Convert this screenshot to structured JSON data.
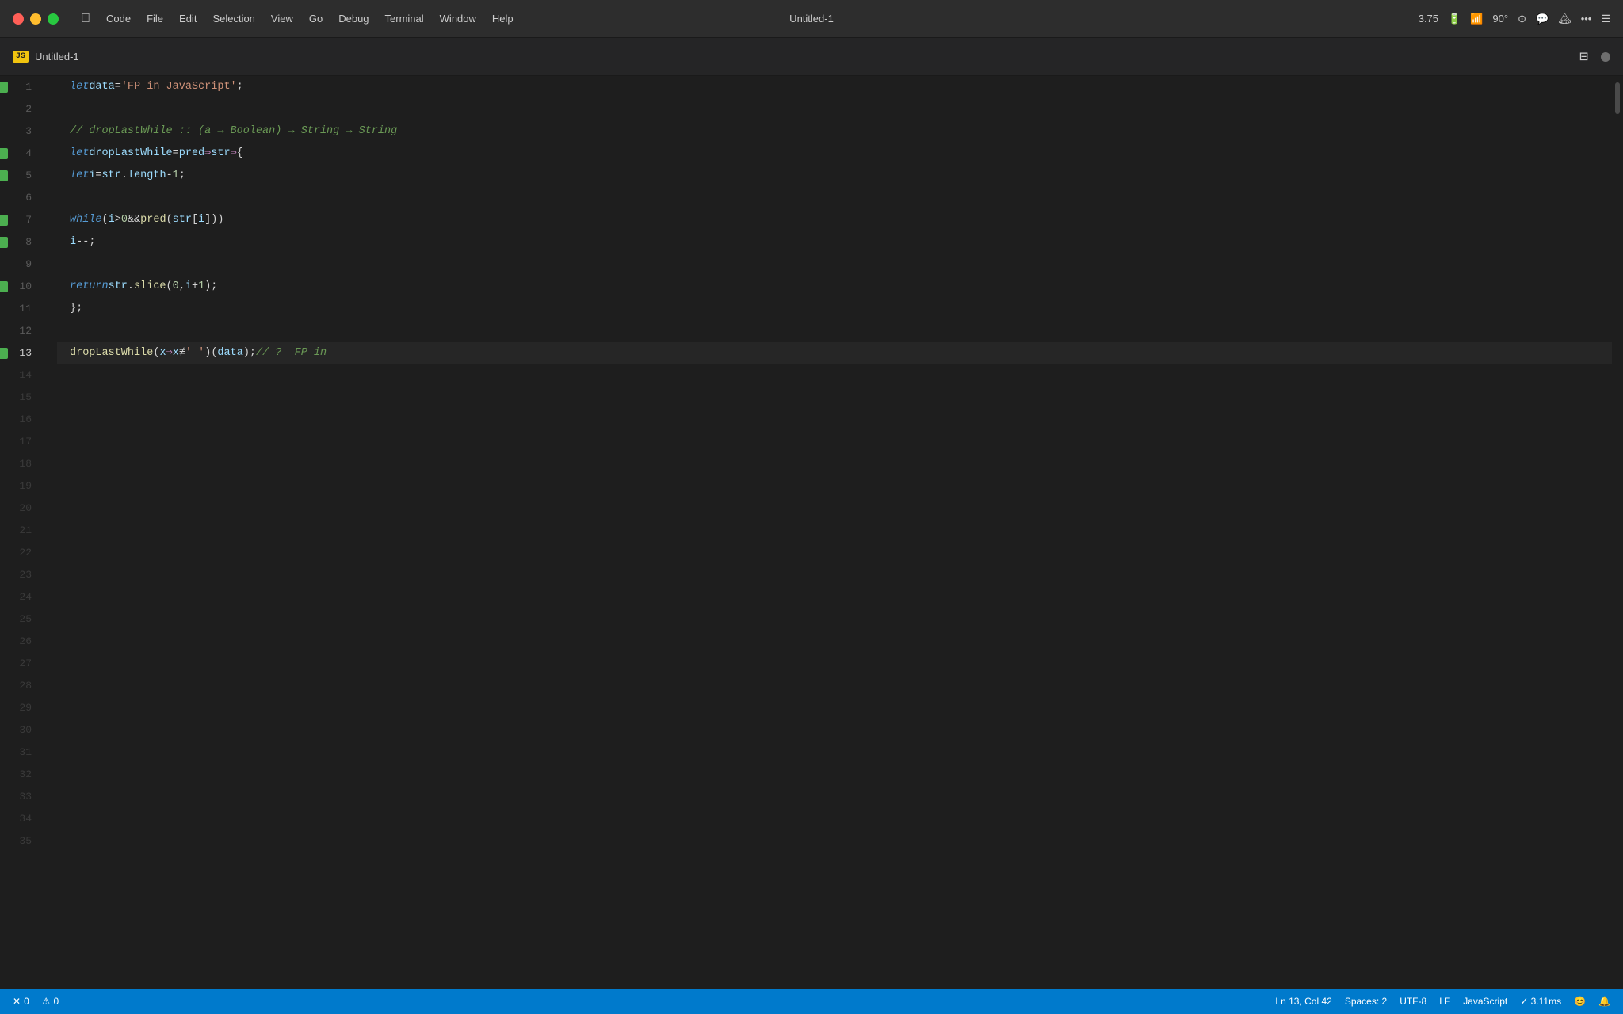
{
  "titlebar": {
    "title": "Untitled-1",
    "menu_items": [
      "",
      "Code",
      "File",
      "Edit",
      "Selection",
      "View",
      "Go",
      "Debug",
      "Terminal",
      "Window",
      "Help"
    ],
    "system_status": "3.75",
    "battery": "🔋",
    "wifi": "WiFi",
    "brightness": "90°"
  },
  "editor": {
    "tab_label": "Untitled-1",
    "tab_icon": "JS"
  },
  "lines": [
    {
      "num": 1,
      "breakpoint": true,
      "code_html": "<span class='kw'>let</span> <span class='var-name'>data</span> <span class='op'>=</span> <span class='str'>'FP in JavaScript'</span><span class='punc'>;</span>"
    },
    {
      "num": 2,
      "breakpoint": false,
      "code_html": ""
    },
    {
      "num": 3,
      "breakpoint": false,
      "code_html": "<span class='cm'>// dropLastWhile :: (a → Boolean) → String → String</span>"
    },
    {
      "num": 4,
      "breakpoint": true,
      "code_html": "<span class='kw'>let</span> <span class='var-name'>dropLastWhile</span> <span class='op'>=</span> <span class='var-name'>pred</span> <span class='arrow'>⇒</span> <span class='var-name'>str</span> <span class='arrow'>⇒</span> <span class='punc'>{</span>"
    },
    {
      "num": 5,
      "breakpoint": true,
      "code_html": "  <span class='kw'>let</span> <span class='var-name'>i</span> <span class='op'>=</span> <span class='var-name'>str</span><span class='punc'>.</span><span class='prop'>length</span> <span class='op'>-</span> <span class='num'>1</span><span class='punc'>;</span>"
    },
    {
      "num": 6,
      "breakpoint": false,
      "code_html": ""
    },
    {
      "num": 7,
      "breakpoint": true,
      "code_html": "  <span class='kw'>while</span><span class='punc'>(</span><span class='var-name'>i</span> <span class='op'>></span> <span class='num'>0</span> <span class='op'>&&</span> <span class='fn'>pred</span><span class='punc'>(</span><span class='var-name'>str</span><span class='punc'>[</span><span class='var-name'>i</span><span class='punc'>]))</span>"
    },
    {
      "num": 8,
      "breakpoint": true,
      "code_html": "    <span class='var-name'>i</span><span class='op'>--</span><span class='punc'>;</span>"
    },
    {
      "num": 9,
      "breakpoint": false,
      "code_html": ""
    },
    {
      "num": 10,
      "breakpoint": true,
      "code_html": "  <span class='kw'>return</span> <span class='var-name'>str</span><span class='punc'>.</span><span class='fn'>slice</span><span class='punc'>(</span><span class='num'>0</span><span class='punc'>,</span> <span class='var-name'>i</span> <span class='op'>+</span> <span class='num'>1</span><span class='punc'>);</span>"
    },
    {
      "num": 11,
      "breakpoint": false,
      "code_html": "<span class='punc'>};</span>"
    },
    {
      "num": 12,
      "breakpoint": false,
      "code_html": ""
    },
    {
      "num": 13,
      "breakpoint": true,
      "active": true,
      "code_html": "<span class='fn'>dropLastWhile</span><span class='punc'>(</span><span class='var-name'>x</span> <span class='arrow'>⇒</span> <span class='var-name'>x</span> <span class='op'>≢</span> <span class='str'>' '</span><span class='punc'>)(</span><span class='var-name'>data</span><span class='punc'>);</span> <span class='cm'>// ?  FP in</span>"
    }
  ],
  "status_bar": {
    "errors": "0",
    "warnings": "0",
    "position": "Ln 13, Col 42",
    "spaces": "Spaces: 2",
    "encoding": "UTF-8",
    "line_ending": "LF",
    "language": "JavaScript",
    "timing": "✓ 3.11ms",
    "emoji": "😊",
    "bell": "🔔"
  }
}
